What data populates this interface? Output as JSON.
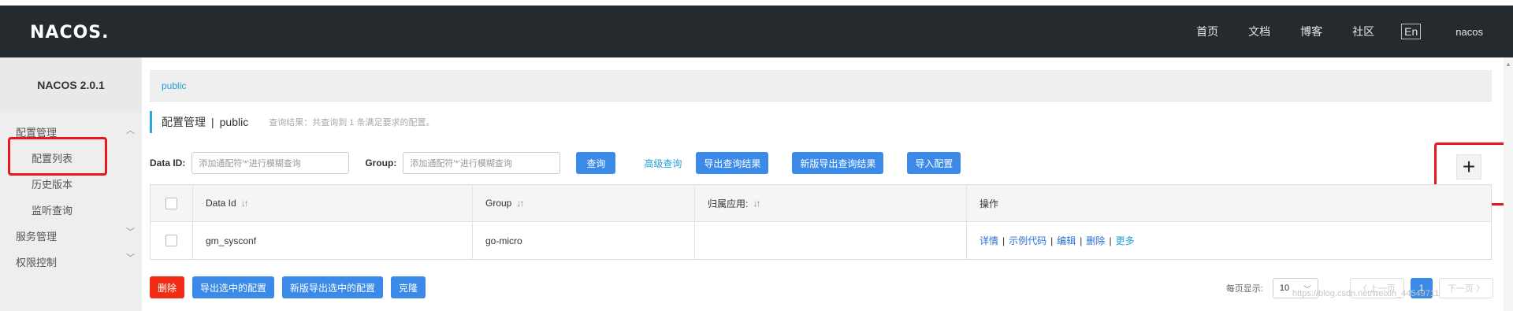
{
  "topbar": {
    "logo": "NACOS.",
    "nav": [
      "首页",
      "文档",
      "博客",
      "社区"
    ],
    "lang": "En",
    "user": "nacos"
  },
  "sidebar": {
    "version": "NACOS 2.0.1",
    "groups": [
      {
        "label": "配置管理",
        "chevron": "chevron-up-icon",
        "items": [
          "配置列表",
          "历史版本",
          "监听查询"
        ]
      },
      {
        "label": "服务管理",
        "chevron": "chevron-down-icon"
      },
      {
        "label": "权限控制",
        "chevron": "chevron-down-icon"
      }
    ]
  },
  "breadcrumb": "public",
  "title": {
    "main": "配置管理",
    "sep": "|",
    "namespace": "public",
    "hint": "查询结果：共查询到 1 条满足要求的配置。"
  },
  "filters": {
    "dataid_label": "Data ID:",
    "dataid_placeholder": "添加通配符'*'进行模糊查询",
    "group_label": "Group:",
    "group_placeholder": "添加通配符'*'进行模糊查询",
    "query": "查询",
    "advanced": "高级查询",
    "export": "导出查询结果",
    "export_new": "新版导出查询结果",
    "import": "导入配置"
  },
  "table": {
    "headers": [
      "Data Id",
      "Group",
      "归属应用:",
      "操作"
    ],
    "sort_icon": "↓↑",
    "rows": [
      {
        "data_id": "gm_sysconf",
        "group": "go-micro",
        "app": "",
        "ops": [
          "详情",
          "示例代码",
          "编辑",
          "删除",
          "更多"
        ]
      }
    ]
  },
  "bottom": {
    "delete": "删除",
    "export_selected": "导出选中的配置",
    "export_selected_new": "新版导出选中的配置",
    "clone": "克隆"
  },
  "pager": {
    "label": "每页显示:",
    "size": "10",
    "prev": "〈 上一页",
    "page": "1",
    "next": "下一页 〉"
  },
  "watermark": "https://blog.csdn.net/weixin_44549711",
  "colors": {
    "accent": "#3b8ae8",
    "danger": "#f02d14",
    "highlight": "#e8171f",
    "topbar": "#252a2f"
  }
}
